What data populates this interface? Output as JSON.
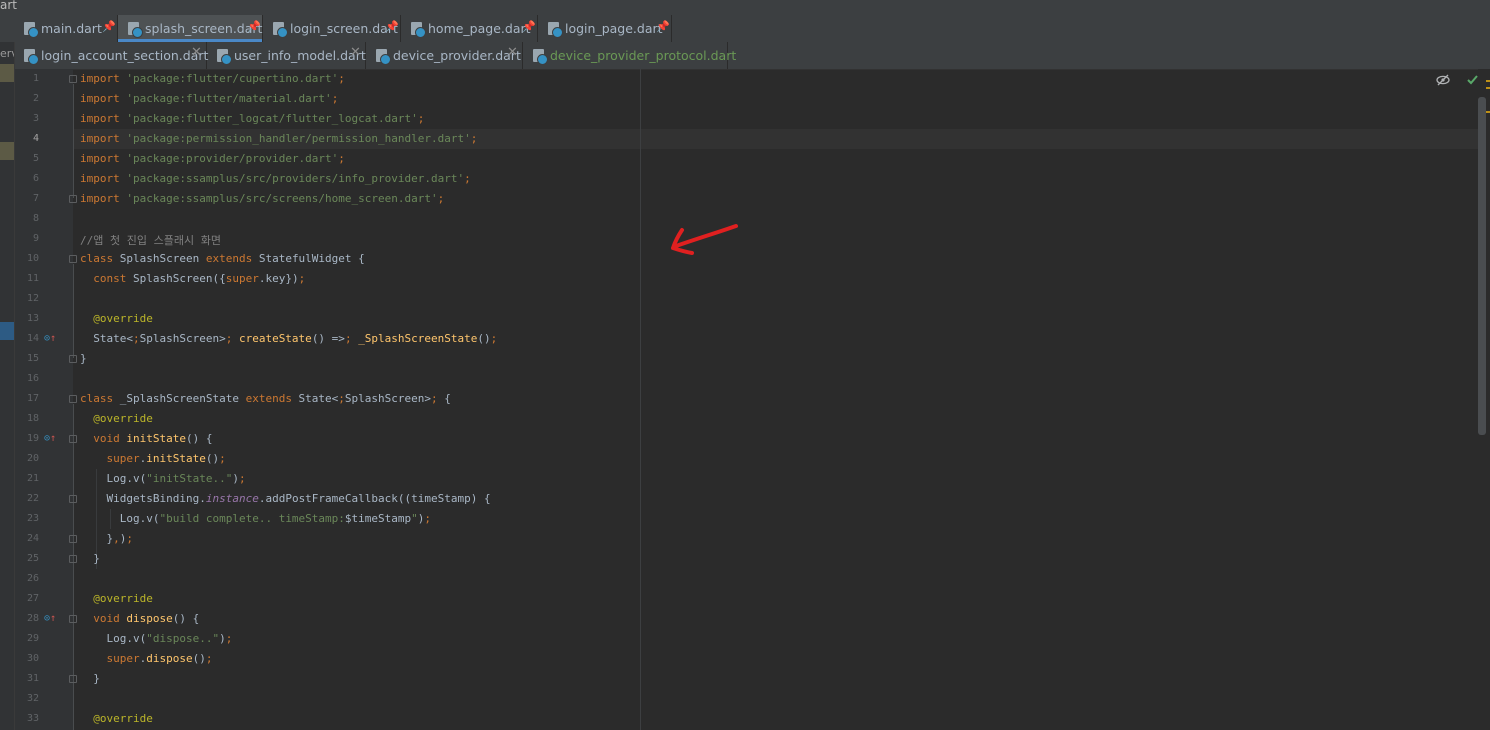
{
  "window": {
    "title_fragment": "art"
  },
  "tabs_row1": [
    {
      "label": "main.dart",
      "action": "pin"
    },
    {
      "label": "splash_screen.dart",
      "action": "pin",
      "active": true
    },
    {
      "label": "login_screen.dart",
      "action": "pin"
    },
    {
      "label": "home_page.dart",
      "action": "pin"
    },
    {
      "label": "login_page.dart",
      "action": "pin"
    }
  ],
  "tabs_row2": [
    {
      "label": "login_account_section.dart",
      "action": "close"
    },
    {
      "label": "user_info_model.dart",
      "action": "close"
    },
    {
      "label": "device_provider.dart",
      "action": "close"
    },
    {
      "label": "device_provider_protocol.dart",
      "action": "none"
    }
  ],
  "side_panel_fragment": "ervi",
  "editor": {
    "current_line": 4,
    "line_numbers": [
      "1",
      "2",
      "3",
      "4",
      "5",
      "6",
      "7",
      "8",
      "9",
      "10",
      "11",
      "12",
      "13",
      "14",
      "15",
      "16",
      "17",
      "18",
      "19",
      "20",
      "21",
      "22",
      "23",
      "24",
      "25",
      "26",
      "27",
      "28",
      "29",
      "30",
      "31",
      "32",
      "33"
    ],
    "lines": [
      "import 'package:flutter/cupertino.dart';",
      "import 'package:flutter/material.dart';",
      "import 'package:flutter_logcat/flutter_logcat.dart';",
      "import 'package:permission_handler/permission_handler.dart';",
      "import 'package:provider/provider.dart';",
      "import 'package:ssamplus/src/providers/info_provider.dart';",
      "import 'package:ssamplus/src/screens/home_screen.dart';",
      "",
      "//앱 첫 진입 스플래시 화면",
      "class SplashScreen extends StatefulWidget {",
      "  const SplashScreen({super.key});",
      "",
      "  @override",
      "  State<SplashScreen> createState() => _SplashScreenState();",
      "}",
      "",
      "class _SplashScreenState extends State<SplashScreen> {",
      "  @override",
      "  void initState() {",
      "    super.initState();",
      "    Log.v(\"initState..\");",
      "    WidgetsBinding.instance.addPostFrameCallback((timeStamp) {",
      "      Log.v(\"build complete.. timeStamp:$timeStamp\");",
      "    },);",
      "  }",
      "",
      "  @override",
      "  void dispose() {",
      "    Log.v(\"dispose..\");",
      "    super.dispose();",
      "  }",
      "",
      "  @override"
    ],
    "gutter_icons": {
      "14": "override-icon",
      "19": "override-icon",
      "28": "override-icon"
    }
  },
  "toolbar": {
    "reader_mode_icon": "eye-crossed-icon",
    "status_icon": "checkmark-icon"
  },
  "annotation": {
    "arrow_color": "#e02020"
  },
  "colors": {
    "keyword": "#cc7832",
    "string": "#6a8759",
    "comment": "#808080",
    "annotation": "#bbb529",
    "function": "#ffc66d",
    "field": "#9876aa",
    "text": "#a9b7c6",
    "editor_bg": "#2b2b2b",
    "active_tab_underline": "#4a88c7"
  }
}
